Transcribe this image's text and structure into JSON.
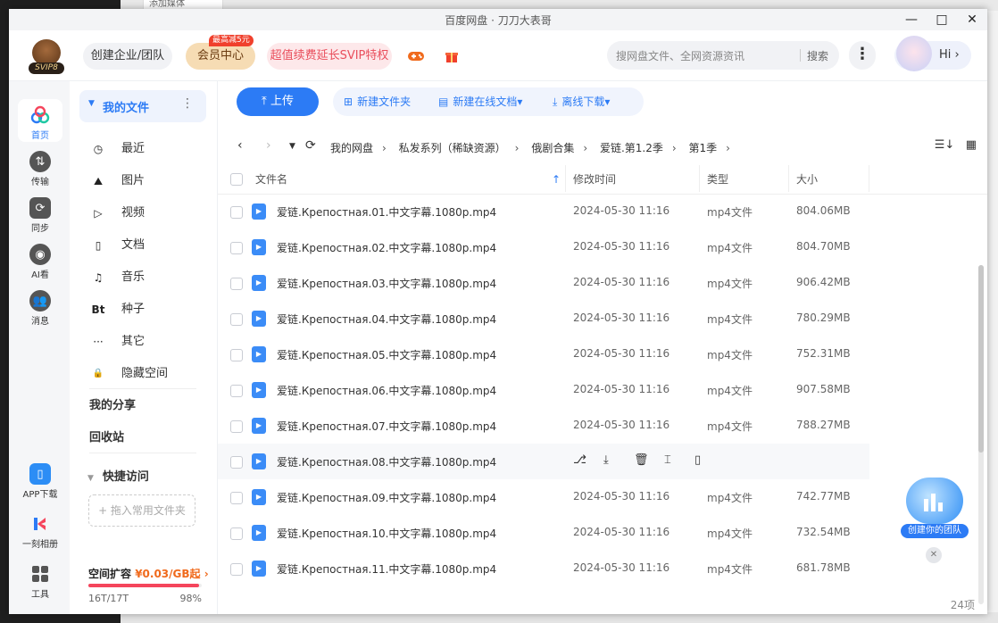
{
  "window": {
    "title": "百度网盘 · 刀刀大表哥",
    "minimize": "—",
    "maximize": "□",
    "close": "✕"
  },
  "background": {
    "tag_text": "添加媒体"
  },
  "header": {
    "svip_badge": "SVIP8",
    "enterprise": "创建企业/团队",
    "vip_center": "会员中心",
    "vip_tag": "最高减5元",
    "renew": "超值续费延长SVIP特权",
    "search_placeholder": "搜网盘文件、全网资源资讯",
    "search_button": "搜索",
    "more": "⋮",
    "hi": "Hi",
    "hi_arrow": "›"
  },
  "rail": {
    "items": [
      {
        "label": "首页",
        "icon": "home-icon"
      },
      {
        "label": "传输",
        "icon": "transfer-icon"
      },
      {
        "label": "同步",
        "icon": "sync-icon"
      },
      {
        "label": "AI看",
        "icon": "ai-icon"
      },
      {
        "label": "消息",
        "icon": "message-icon"
      }
    ],
    "bottom": [
      {
        "label": "APP下载",
        "icon": "phone-icon"
      },
      {
        "label": "一刻相册",
        "icon": "album-icon"
      },
      {
        "label": "工具",
        "icon": "tools-icon"
      }
    ]
  },
  "nav": {
    "my_files": "我的文件",
    "items": [
      {
        "label": "最近",
        "icon_glyph": "◷"
      },
      {
        "label": "图片",
        "icon_glyph": "⛰"
      },
      {
        "label": "视频",
        "icon_glyph": "▷"
      },
      {
        "label": "文档",
        "icon_glyph": "▯"
      },
      {
        "label": "音乐",
        "icon_glyph": "♫"
      },
      {
        "label": "种子",
        "icon_glyph": "Bt"
      },
      {
        "label": "其它",
        "icon_glyph": "···"
      },
      {
        "label": "隐藏空间",
        "icon_glyph": "🔒"
      }
    ],
    "my_share": "我的分享",
    "recycle": "回收站",
    "quick_access": "快捷访问",
    "drop_hint": "+ 拖入常用文件夹",
    "space_title": "空间扩容",
    "space_price": "¥0.03/GB起",
    "space_used": "16T/17T",
    "space_percent": "98%",
    "space_fraction": 0.98
  },
  "toolbar": {
    "upload": "上传",
    "new_folder": "新建文件夹",
    "new_online_doc": "新建在线文档",
    "offline_download": "离线下载"
  },
  "breadcrumb": [
    {
      "label": "我的网盘"
    },
    {
      "label": "私发系列（稀缺资源）"
    },
    {
      "label": "俄剧合集"
    },
    {
      "label": "爱链.第1.2季"
    },
    {
      "label": "第1季"
    }
  ],
  "table": {
    "col_name": "文件名",
    "col_modified": "修改时间",
    "col_type": "类型",
    "col_size": "大小",
    "rows": [
      {
        "name": "爱链.Крепостная.01.中文字幕.1080p.mp4",
        "modified": "2024-05-30 11:16",
        "type": "mp4文件",
        "size": "804.06MB"
      },
      {
        "name": "爱链.Крепостная.02.中文字幕.1080p.mp4",
        "modified": "2024-05-30 11:16",
        "type": "mp4文件",
        "size": "804.70MB"
      },
      {
        "name": "爱链.Крепостная.03.中文字幕.1080p.mp4",
        "modified": "2024-05-30 11:16",
        "type": "mp4文件",
        "size": "906.42MB"
      },
      {
        "name": "爱链.Крепостная.04.中文字幕.1080p.mp4",
        "modified": "2024-05-30 11:16",
        "type": "mp4文件",
        "size": "780.29MB"
      },
      {
        "name": "爱链.Крепостная.05.中文字幕.1080p.mp4",
        "modified": "2024-05-30 11:16",
        "type": "mp4文件",
        "size": "752.31MB"
      },
      {
        "name": "爱链.Крепостная.06.中文字幕.1080p.mp4",
        "modified": "2024-05-30 11:16",
        "type": "mp4文件",
        "size": "907.58MB"
      },
      {
        "name": "爱链.Крепостная.07.中文字幕.1080p.mp4",
        "modified": "2024-05-30 11:16",
        "type": "mp4文件",
        "size": "788.27MB"
      },
      {
        "name": "爱链.Крепостная.08.中文字幕.1080p.mp4",
        "modified": "",
        "type": "",
        "size": "",
        "hovered": true
      },
      {
        "name": "爱链.Крепостная.09.中文字幕.1080p.mp4",
        "modified": "2024-05-30 11:16",
        "type": "mp4文件",
        "size": "742.77MB"
      },
      {
        "name": "爱链.Крепостная.10.中文字幕.1080p.mp4",
        "modified": "2024-05-30 11:16",
        "type": "mp4文件",
        "size": "732.54MB"
      },
      {
        "name": "爱链.Крепостная.11.中文字幕.1080p.mp4",
        "modified": "2024-05-30 11:16",
        "type": "mp4文件",
        "size": "681.78MB"
      }
    ],
    "hover_actions": [
      "share-icon",
      "download-icon",
      "delete-icon",
      "rename-icon",
      "send-to-phone-icon"
    ],
    "item_count": "24项"
  },
  "team_widget": {
    "label": "创建你的团队",
    "close": "✕"
  },
  "colors": {
    "accent": "#2c7bf5",
    "renew": "#e94e5c",
    "vip_bg": "#f6dcb4",
    "space_bar": "#f5455c"
  }
}
